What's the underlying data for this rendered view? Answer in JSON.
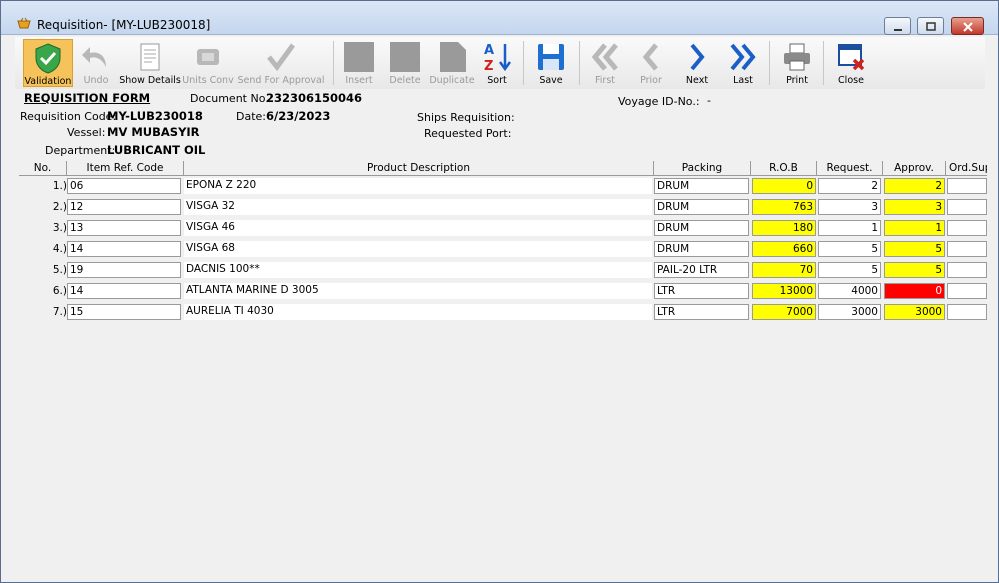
{
  "window": {
    "title": "Requisition- [MY-LUB230018]"
  },
  "toolbar": {
    "items": [
      {
        "label": "Validation",
        "icon": "shield-check-icon",
        "enabled": true,
        "active": true
      },
      {
        "label": "Undo",
        "icon": "undo-arrow-icon",
        "enabled": false
      },
      {
        "label": "Show Details",
        "icon": "document-details-icon",
        "enabled": true
      },
      {
        "label": "Units Conv",
        "icon": "units-convert-icon",
        "enabled": false
      },
      {
        "label": "Send For Approval",
        "icon": "checkmark-icon",
        "enabled": false
      },
      {
        "label": "Insert",
        "icon": "insert-icon",
        "enabled": false
      },
      {
        "label": "Delete",
        "icon": "delete-icon",
        "enabled": false
      },
      {
        "label": "Duplicate",
        "icon": "duplicate-icon",
        "enabled": false
      },
      {
        "label": "Sort",
        "icon": "sort-az-icon",
        "enabled": true
      },
      {
        "label": "Save",
        "icon": "floppy-disk-icon",
        "enabled": true
      },
      {
        "label": "First",
        "icon": "first-record-icon",
        "enabled": false
      },
      {
        "label": "Prior",
        "icon": "prior-record-icon",
        "enabled": false
      },
      {
        "label": "Next",
        "icon": "next-record-icon",
        "enabled": true
      },
      {
        "label": "Last",
        "icon": "last-record-icon",
        "enabled": true
      },
      {
        "label": "Print",
        "icon": "printer-icon",
        "enabled": true
      },
      {
        "label": "Close",
        "icon": "close-window-icon",
        "enabled": true
      }
    ]
  },
  "form": {
    "heading": "REQUISITION FORM",
    "document_no_label": "Document No.:",
    "document_no": "232306150046",
    "voyage_label": "Voyage ID-No.:",
    "voyage_value": "-",
    "req_code_label": "Requisition Code:",
    "req_code": "MY-LUB230018",
    "date_label": "Date:",
    "date": "6/23/2023",
    "ships_req_label": "Ships Requisition:",
    "vessel_label": "Vessel:",
    "vessel": "MV MUBASYIR",
    "req_port_label": "Requested Port:",
    "department_label": "Department:",
    "department": "LUBRICANT OIL"
  },
  "grid": {
    "columns": [
      "No.",
      "Item Ref. Code",
      "Product Description",
      "Packing",
      "R.O.B",
      "Request.",
      "Approv.",
      "Ord.Sup"
    ],
    "rows": [
      {
        "no": "1.)",
        "code": "06",
        "desc": "EPONA Z 220",
        "packing": "DRUM",
        "rob": "0",
        "request": "2",
        "approv": "2",
        "approv_status": "yellow"
      },
      {
        "no": "2.)",
        "code": "12",
        "desc": "VISGA 32",
        "packing": "DRUM",
        "rob": "763",
        "request": "3",
        "approv": "3",
        "approv_status": "yellow"
      },
      {
        "no": "3.)",
        "code": "13",
        "desc": "VISGA 46",
        "packing": "DRUM",
        "rob": "180",
        "request": "1",
        "approv": "1",
        "approv_status": "yellow"
      },
      {
        "no": "4.)",
        "code": "14",
        "desc": "VISGA 68",
        "packing": "DRUM",
        "rob": "660",
        "request": "5",
        "approv": "5",
        "approv_status": "yellow"
      },
      {
        "no": "5.)",
        "code": "19",
        "desc": "DACNIS 100**",
        "packing": "PAIL-20 LTR",
        "rob": "70",
        "request": "5",
        "approv": "5",
        "approv_status": "yellow"
      },
      {
        "no": "6.)",
        "code": "14",
        "desc": "ATLANTA MARINE D 3005",
        "packing": "LTR",
        "rob": "13000",
        "request": "4000",
        "approv": "0",
        "approv_status": "red"
      },
      {
        "no": "7.)",
        "code": "15",
        "desc": "AURELIA TI 4030",
        "packing": "LTR",
        "rob": "7000",
        "request": "3000",
        "approv": "3000",
        "approv_status": "yellow"
      }
    ]
  },
  "colors": {
    "highlight_yellow": "#ffff00",
    "alert_red": "#ff0000",
    "active_button": "#f6c35a"
  }
}
